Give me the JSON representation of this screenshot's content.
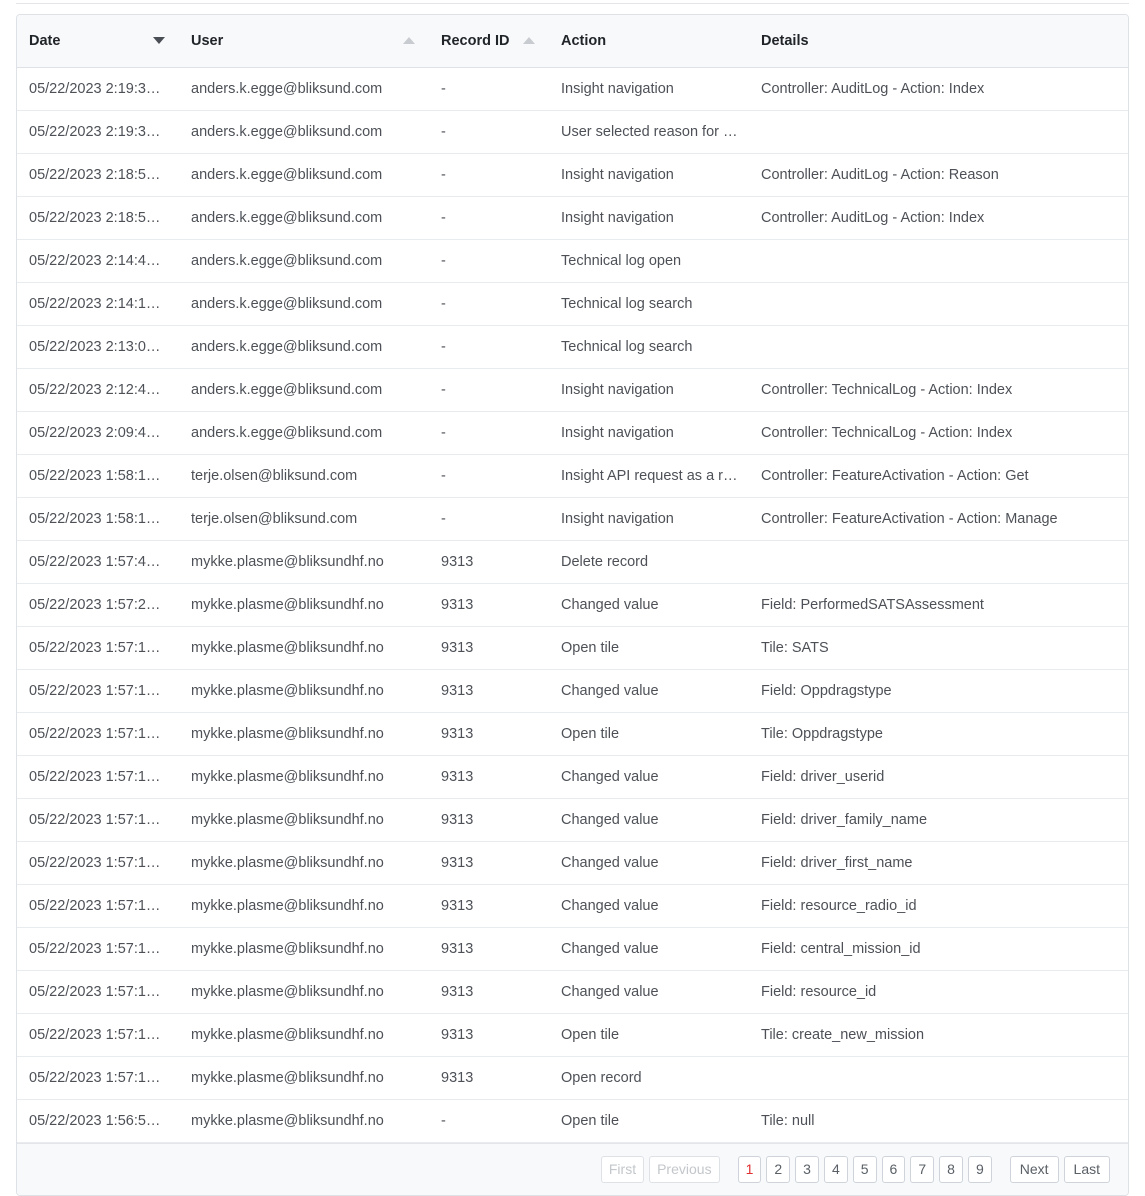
{
  "table": {
    "columns": [
      {
        "label": "Date",
        "sort": "desc",
        "key": "date"
      },
      {
        "label": "User",
        "sort": "asc",
        "key": "user"
      },
      {
        "label": "Record ID",
        "sort": "asc",
        "key": "record_id"
      },
      {
        "label": "Action",
        "sort": "none",
        "key": "action"
      },
      {
        "label": "Details",
        "sort": "none",
        "key": "details"
      }
    ],
    "rows": [
      {
        "date": "05/22/2023 2:19:3…",
        "user": "anders.k.egge@bliksund.com",
        "record_id": "-",
        "action": "Insight navigation",
        "details": "Controller: AuditLog - Action: Index"
      },
      {
        "date": "05/22/2023 2:19:3…",
        "user": "anders.k.egge@bliksund.com",
        "record_id": "-",
        "action": "User selected reason for …",
        "details": ""
      },
      {
        "date": "05/22/2023 2:18:5…",
        "user": "anders.k.egge@bliksund.com",
        "record_id": "-",
        "action": "Insight navigation",
        "details": "Controller: AuditLog - Action: Reason"
      },
      {
        "date": "05/22/2023 2:18:5…",
        "user": "anders.k.egge@bliksund.com",
        "record_id": "-",
        "action": "Insight navigation",
        "details": "Controller: AuditLog - Action: Index"
      },
      {
        "date": "05/22/2023 2:14:4…",
        "user": "anders.k.egge@bliksund.com",
        "record_id": "-",
        "action": "Technical log open",
        "details": ""
      },
      {
        "date": "05/22/2023 2:14:1…",
        "user": "anders.k.egge@bliksund.com",
        "record_id": "-",
        "action": "Technical log search",
        "details": ""
      },
      {
        "date": "05/22/2023 2:13:0…",
        "user": "anders.k.egge@bliksund.com",
        "record_id": "-",
        "action": "Technical log search",
        "details": ""
      },
      {
        "date": "05/22/2023 2:12:4…",
        "user": "anders.k.egge@bliksund.com",
        "record_id": "-",
        "action": "Insight navigation",
        "details": "Controller: TechnicalLog - Action: Index"
      },
      {
        "date": "05/22/2023 2:09:4…",
        "user": "anders.k.egge@bliksund.com",
        "record_id": "-",
        "action": "Insight navigation",
        "details": "Controller: TechnicalLog - Action: Index"
      },
      {
        "date": "05/22/2023 1:58:1…",
        "user": "terje.olsen@bliksund.com",
        "record_id": "-",
        "action": "Insight API request as a r…",
        "details": "Controller: FeatureActivation - Action: Get"
      },
      {
        "date": "05/22/2023 1:58:1…",
        "user": "terje.olsen@bliksund.com",
        "record_id": "-",
        "action": "Insight navigation",
        "details": "Controller: FeatureActivation - Action: Manage"
      },
      {
        "date": "05/22/2023 1:57:4…",
        "user": "mykke.plasme@bliksundhf.no",
        "record_id": "9313",
        "action": "Delete record",
        "details": ""
      },
      {
        "date": "05/22/2023 1:57:2…",
        "user": "mykke.plasme@bliksundhf.no",
        "record_id": "9313",
        "action": "Changed value",
        "details": "Field: PerformedSATSAssessment"
      },
      {
        "date": "05/22/2023 1:57:1…",
        "user": "mykke.plasme@bliksundhf.no",
        "record_id": "9313",
        "action": "Open tile",
        "details": "Tile: SATS"
      },
      {
        "date": "05/22/2023 1:57:1…",
        "user": "mykke.plasme@bliksundhf.no",
        "record_id": "9313",
        "action": "Changed value",
        "details": "Field: Oppdragstype"
      },
      {
        "date": "05/22/2023 1:57:1…",
        "user": "mykke.plasme@bliksundhf.no",
        "record_id": "9313",
        "action": "Open tile",
        "details": "Tile: Oppdragstype"
      },
      {
        "date": "05/22/2023 1:57:1…",
        "user": "mykke.plasme@bliksundhf.no",
        "record_id": "9313",
        "action": "Changed value",
        "details": "Field: driver_userid"
      },
      {
        "date": "05/22/2023 1:57:1…",
        "user": "mykke.plasme@bliksundhf.no",
        "record_id": "9313",
        "action": "Changed value",
        "details": "Field: driver_family_name"
      },
      {
        "date": "05/22/2023 1:57:1…",
        "user": "mykke.plasme@bliksundhf.no",
        "record_id": "9313",
        "action": "Changed value",
        "details": "Field: driver_first_name"
      },
      {
        "date": "05/22/2023 1:57:1…",
        "user": "mykke.plasme@bliksundhf.no",
        "record_id": "9313",
        "action": "Changed value",
        "details": "Field: resource_radio_id"
      },
      {
        "date": "05/22/2023 1:57:1…",
        "user": "mykke.plasme@bliksundhf.no",
        "record_id": "9313",
        "action": "Changed value",
        "details": "Field: central_mission_id"
      },
      {
        "date": "05/22/2023 1:57:1…",
        "user": "mykke.plasme@bliksundhf.no",
        "record_id": "9313",
        "action": "Changed value",
        "details": "Field: resource_id"
      },
      {
        "date": "05/22/2023 1:57:1…",
        "user": "mykke.plasme@bliksundhf.no",
        "record_id": "9313",
        "action": "Open tile",
        "details": "Tile: create_new_mission"
      },
      {
        "date": "05/22/2023 1:57:1…",
        "user": "mykke.plasme@bliksundhf.no",
        "record_id": "9313",
        "action": "Open record",
        "details": ""
      },
      {
        "date": "05/22/2023 1:56:5…",
        "user": "mykke.plasme@bliksundhf.no",
        "record_id": "-",
        "action": "Open tile",
        "details": "Tile: null"
      }
    ]
  },
  "pagination": {
    "first_label": "First",
    "previous_label": "Previous",
    "next_label": "Next",
    "last_label": "Last",
    "pages": [
      "1",
      "2",
      "3",
      "4",
      "5",
      "6",
      "7",
      "8",
      "9"
    ],
    "current_page": "1",
    "first_disabled": true,
    "previous_disabled": true,
    "active_color": "#e03131"
  }
}
